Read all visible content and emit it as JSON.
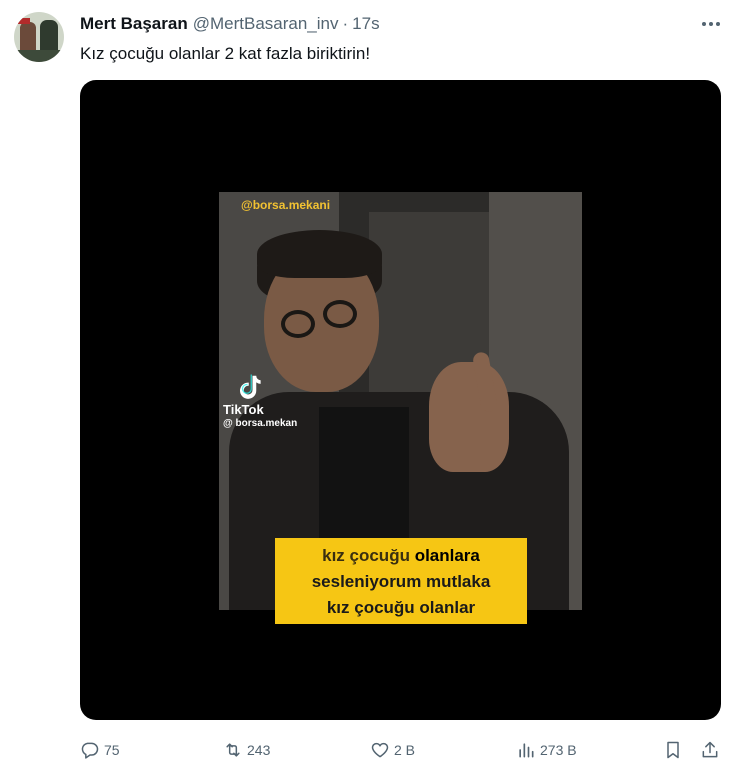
{
  "author": {
    "name": "Mert Başaran",
    "handle": "@MertBasaran_inv",
    "separator": "·",
    "time": "17s"
  },
  "tweet": {
    "text": "Kız çocuğu olanlar 2 kat fazla biriktirin!"
  },
  "video": {
    "watermark": "@borsa.mekani",
    "tiktok_label": "TikTok",
    "tiktok_user": "@ borsa.mekan",
    "caption": {
      "line1_part1": "kız çocuğu ",
      "line1_part2": "olanlara",
      "line2": "sesleniyorum mutlaka",
      "line3": "kız çocuğu olanlar"
    },
    "colors": {
      "caption_bg": "#f6c614",
      "watermark": "#f2c232"
    }
  },
  "actions": {
    "replies": "75",
    "retweets": "243",
    "likes": "2 B",
    "views": "273 B"
  },
  "icons": {
    "reply": "reply-icon",
    "retweet": "retweet-icon",
    "like": "heart-icon",
    "views": "views-icon",
    "bookmark": "bookmark-icon",
    "share": "share-icon",
    "more": "more-icon"
  }
}
